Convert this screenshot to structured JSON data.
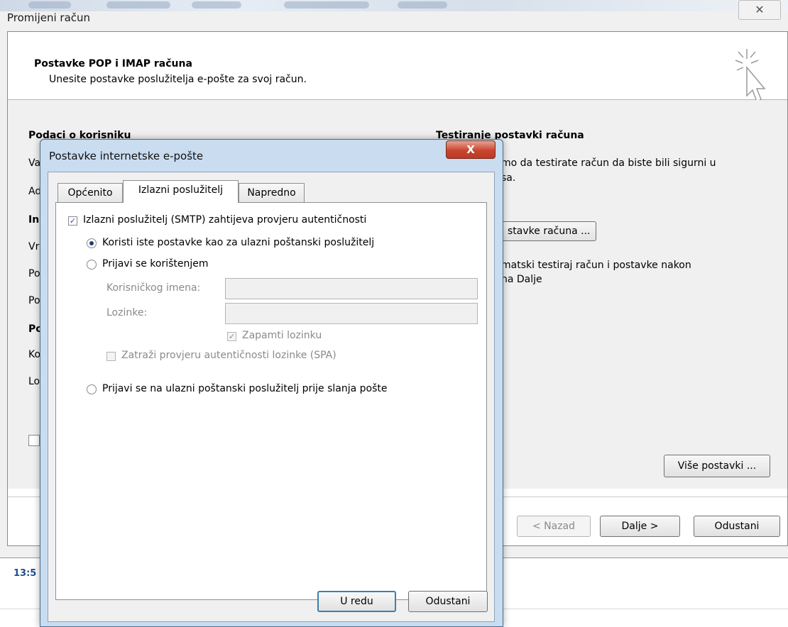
{
  "main_window": {
    "title": "Promijeni račun",
    "close_glyph": "✕",
    "header": {
      "title": "Postavke POP i IMAP računa",
      "subtitle": "Unesite postavke poslužitelja e-pošte za svoj račun.",
      "icon": "wand-cursor-icon"
    },
    "user_section_title": "Podaci o korisniku",
    "left_obscured_labels": [
      "Va",
      "Ad",
      "In",
      "Vr",
      "Po",
      "Po",
      "Po",
      "Ko",
      "Lo"
    ],
    "test_section": {
      "title": "Testiranje postavki računa",
      "text_line1": "mo da testirate račun da biste bili sigurni u",
      "text_line2": "sa.",
      "test_button": "stavke računa ...",
      "auto_line1": "matski testiraj račun i postavke nakon",
      "auto_line2": "na Dalje"
    },
    "more_settings_button": "Više postavki ...",
    "footer": {
      "back": "< Nazad",
      "next": "Dalje >",
      "cancel": "Odustani"
    }
  },
  "timestamp": "13:5",
  "dialog": {
    "title": "Postavke internetske e-pošte",
    "close_glyph": "X",
    "tabs": [
      "Općenito",
      "Izlazni poslužitelj",
      "Napredno"
    ],
    "active_tab": "Izlazni poslužitelj",
    "smtp_auth": {
      "label": "Izlazni poslužitelj (SMTP) zahtijeva provjeru autentičnosti",
      "checked": true
    },
    "options": {
      "same_settings": {
        "label": "Koristi iste postavke kao za ulazni poštanski poslužitelj",
        "selected": true
      },
      "login_with": {
        "label": "Prijavi se korištenjem",
        "selected": false
      },
      "login_before": {
        "label": "Prijavi se na ulazni poštanski poslužitelj prije slanja pošte",
        "selected": false
      }
    },
    "username_label": "Korisničkog imena:",
    "username_value": "",
    "password_label": "Lozinke:",
    "password_value": "",
    "remember_password": {
      "label": "Zapamti lozinku",
      "checked": true,
      "disabled": true
    },
    "spa": {
      "label": "Zatraži provjeru autentičnosti lozinke (SPA)",
      "checked": false,
      "disabled": true
    },
    "buttons": {
      "ok": "U redu",
      "cancel": "Odustani"
    }
  },
  "colors": {
    "dialog_frame": "#c9dcf0",
    "close_red": "#c9452f",
    "focus_blue": "#3c7fb1"
  }
}
